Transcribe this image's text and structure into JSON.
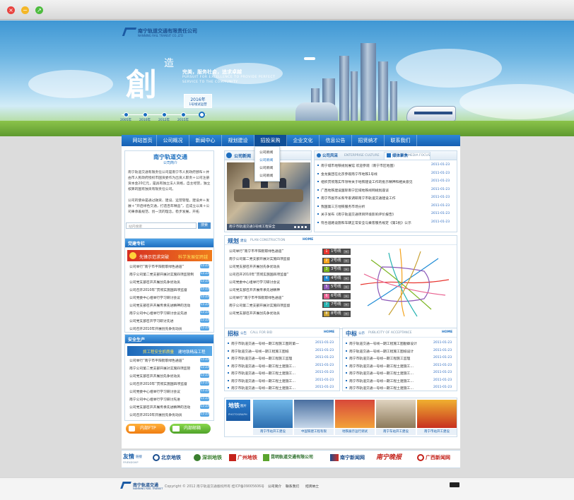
{
  "window": {
    "close": "×",
    "minimize": "−",
    "maximize": "↗"
  },
  "header": {
    "logo_cn": "南宁轨道交通有限责任公司",
    "logo_en": "NANNING RAIL TRANSIT CO.,LTD",
    "slogan_big": "創",
    "slogan_small": "造",
    "slogan_cn": "完美，服务社会，追求卓越",
    "slogan_en1": "PURSUIT FOR EXCELLENCE TO PROVIDE PERFECT",
    "slogan_en2": "SERVICE TO THE COMMUNITY",
    "plan_year": "2016年",
    "plan_text": "1号线试运营",
    "timeline": [
      "2005年",
      "2010年",
      "2012年",
      "2015年"
    ]
  },
  "nav": [
    "网站首页",
    "公司概况",
    "新闻中心",
    "规划建设",
    "招投采购",
    "企业文化",
    "信息公告",
    "招贤纳才",
    "联系我们"
  ],
  "dropdown": [
    "公司新闻",
    "公司新闻",
    "公司新闻",
    "公司新闻"
  ],
  "intro": {
    "title": "南宁轨道交通",
    "subtitle": "公司简介",
    "text": "南宁轨道交通有限责任公司是南宁市人民政府颁布＋并由市人民政府授权市国资委作为出资人职责＋公司注册资本金20亿元，是具有独立法人资格，自主经营，独立核算的国有独资有限责任公司。",
    "text2": "公司的使命是通过融资、建设、运营管理，建设并＋发展＋“开启绿色交通，打造百年精品”，应成立以来＋公司秉承着规范、创一流的理念，稳步发展，开拓"
  },
  "search": {
    "placeholder": "站内搜索",
    "button": "搜索"
  },
  "party": {
    "title": "党建专栏",
    "banner_left": "先锋示范求突破",
    "banner_right": "科学发展促跨越",
    "items": [
      {
        "text": "公司举行“南宁市平阳街职绿色通道”",
        "date": "11-23"
      },
      {
        "text": "南宁公司第二党支部开展对实施四项监管制",
        "date": "11-23"
      },
      {
        "text": "公司党支部召开开展创先争优动员",
        "date": "11-23"
      },
      {
        "text": "公司召开2010年“贯彻实施国四项监督",
        "date": "11-23"
      },
      {
        "text": "公司党委中心组举行学习研讨会议",
        "date": "11-23"
      },
      {
        "text": "公司党支部召开开展传承先进精神的活动",
        "date": "11-23"
      },
      {
        "text": "南宁公司中心组举行学习研讨会议先进",
        "date": "11-23"
      },
      {
        "text": "公司党支部召开学习研讨先进",
        "date": "11-23"
      },
      {
        "text": "公司召开2010年开展创先争优动员",
        "date": "11-23"
      }
    ]
  },
  "safety": {
    "title": "安全生产",
    "banner_left": "抓工程安全抓质量",
    "banner_right": "建地铁精品工程",
    "items": [
      {
        "text": "公司举行“南宁市平阳街职绿色通道”",
        "date": "11-23"
      },
      {
        "text": "南宁公司第二党支部开展对实施四项监管",
        "date": "11-23"
      },
      {
        "text": "公司党支部召开开展创先争优动员",
        "date": "11-23"
      },
      {
        "text": "公司召开2010年“贯彻实施国四项监督",
        "date": "11-23"
      },
      {
        "text": "公司党委中心组举行学习研讨会议",
        "date": "11-23"
      },
      {
        "text": "南宁公司中心组举行学习研讨先进",
        "date": "11-23"
      },
      {
        "text": "公司党支部召开开展传承先进精神的活动",
        "date": "11-23"
      },
      {
        "text": "公司召开2010年开展创先争优动员",
        "date": "11-23"
      }
    ]
  },
  "buttons": {
    "ftp": "内部FTP",
    "mail": "内部邮箱"
  },
  "news": {
    "tab": "公司新闻",
    "caption": "南宁市轨道交通1号线工程安全",
    "culture_title": "公司风采",
    "culture_en": "ENTERPRISE CULTURE",
    "media_title": "媒体聚焦",
    "media_en": "MEDIA FOCUS",
    "items": [
      {
        "text": "南宁城市地铁规划展馆  欢迎参观（南宁市区地图）",
        "date": "2011-01-23"
      },
      {
        "text": "金龙集团在北京参观南宁市地铁1号线",
        "date": "2011-01-23"
      },
      {
        "text": "组织贯彻落实市领导关于地铁建设工作的批示精神和相关意见",
        "date": "2011-01-23"
      },
      {
        "text": "广西地铁建设国际南宁区域地铁线网规划座谈",
        "date": "2011-01-23"
      },
      {
        "text": "南宁市副市长和专家调研南宁市轨道交通建设工作",
        "date": "2011-01-23"
      },
      {
        "text": "我国第三方地铁服务市场分析",
        "date": "2011-01-23"
      },
      {
        "text": "关于发布《南宁轨道交通项目环境影响评价报告》",
        "date": "2011-01-23"
      },
      {
        "text": "符合道路设施和车辆正常安全与乘客服务规定《第1批》公示",
        "date": "2011-01-23"
      }
    ]
  },
  "planning": {
    "title": "规划",
    "tag": "建设",
    "en": "PLAN CONSTRUCTION",
    "items": [
      "公司举行“南宁市平阳街职绿色通道”",
      "南宁公司第二党支部开展对实施四项监督",
      "公司党支部召开开展创先争优动员",
      "公司召开2010年“贯彻实施国四项监督”",
      "公司党委中心组举行学习研讨会议",
      "公司党支部召开开展传承先进精神",
      "公司举行“南宁市平阳街职绿色通道”",
      "南宁公司第二党支部开展对实施四项监督",
      "公司党支部召开开展创先争优动员"
    ],
    "lines": [
      {
        "name": "1号线",
        "color": "#e8352f"
      },
      {
        "name": "2号线",
        "color": "#f4a21a"
      },
      {
        "name": "3号线",
        "color": "#7bb51f"
      },
      {
        "name": "4号线",
        "color": "#1f8cd6"
      },
      {
        "name": "5号线",
        "color": "#8d59b8"
      },
      {
        "name": "6号线",
        "color": "#e9608f"
      },
      {
        "name": "7号线",
        "color": "#26b3b1"
      },
      {
        "name": "8号线",
        "color": "#c8a030"
      }
    ]
  },
  "bid": {
    "title": "招标",
    "tag": "公告",
    "en": "CALL FOR BID",
    "items": [
      {
        "text": "南宁市轨道交通一号线一期工程施工图的第一",
        "date": "2011-01-23"
      },
      {
        "text": "南宁轨道交通一号线一期工程施工图纸",
        "date": "2011-01-23"
      },
      {
        "text": "南宁市轨道交通一号线一期工程施工监理",
        "date": "2011-01-23"
      },
      {
        "text": "南宁市轨道交通一号线一期工程土建施工…",
        "date": "2011-01-23"
      },
      {
        "text": "南宁市轨道交通一号线一期工程土建施工…",
        "date": "2011-01-23"
      },
      {
        "text": "南宁市轨道交通一号线一期工程土建施工…",
        "date": "2011-01-23"
      },
      {
        "text": "南宁市轨道交通一号线一期工程土建施工…",
        "date": "2011-01-23"
      }
    ]
  },
  "award": {
    "title": "中标",
    "tag": "公示",
    "en": "PUBLICITY OF ACCEPTANCE",
    "items": [
      {
        "text": "南宁轨道交通一号线一期工程施工图勘察设计",
        "date": "2011-01-23"
      },
      {
        "text": "南宁轨道交通一号线一期工程施工图纸设计",
        "date": "2011-01-23"
      },
      {
        "text": "南宁市轨道交通一号线一期工程施工监理",
        "date": "2011-01-23"
      },
      {
        "text": "南宁市轨道交通一号线一期工程土建施工…",
        "date": "2011-01-23"
      },
      {
        "text": "南宁市轨道交通一号线一期工程土建施工…",
        "date": "2011-01-23"
      },
      {
        "text": "南宁市轨道交通一号线一期工程土建施工…",
        "date": "2011-01-23"
      },
      {
        "text": "南宁市轨道交通一号线一期工程土建施工…",
        "date": "2011-01-23"
      }
    ]
  },
  "gallery": {
    "title": "地铁",
    "tag": "图片",
    "en": "PHOTOGRAPH",
    "captions": [
      "南宁市站开工建设",
      "中国铁建工程有限",
      "地铁展示运行调试",
      "南宁车站开工建设",
      "南宁市站开工建设"
    ]
  },
  "links": {
    "title": "友情",
    "tag": "链接",
    "en": "FRIENDSHIP",
    "items": [
      "北京地铁",
      "深圳地铁",
      "广州地铁",
      "昆明轨道交通有限公司",
      "南宁新闻网",
      "南宁晚报",
      "广西新闻网"
    ]
  },
  "footer": {
    "logo": "南宁轨道交通",
    "logo_en": "NANNING RAIL TRANSIT",
    "copyright": "Copyright © 2012  南宁轨道交通版权所有 桂ICP备09005606号",
    "links": [
      "公司简介",
      "联系我们",
      "招贤纳士"
    ]
  }
}
